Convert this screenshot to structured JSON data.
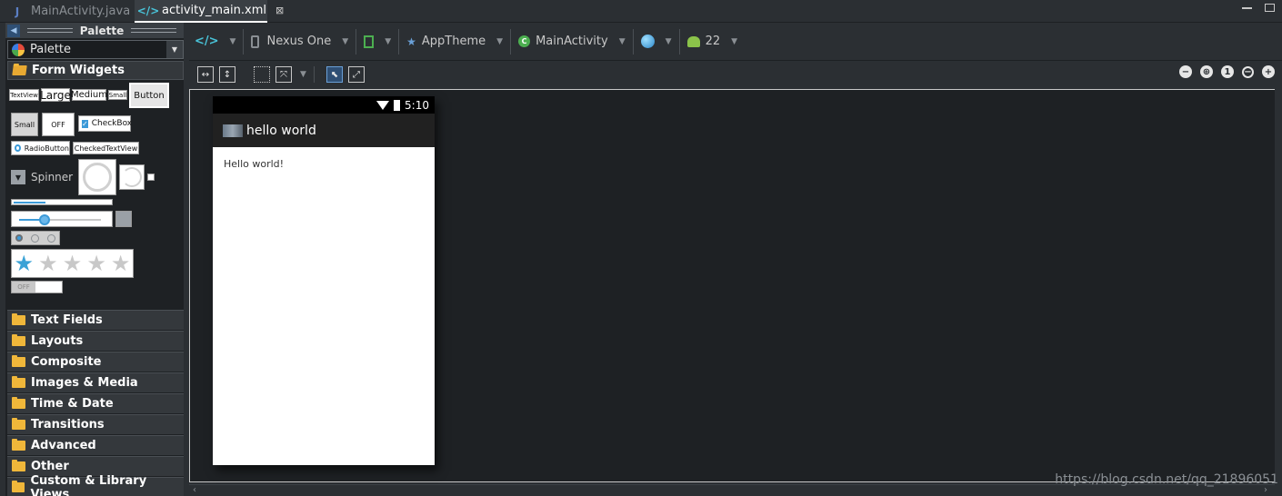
{
  "tabs": [
    {
      "label": "MainActivity.java",
      "icon": "java-file-icon"
    },
    {
      "label": "activity_main.xml",
      "icon": "xml-file-icon",
      "close": "⊠"
    }
  ],
  "palette": {
    "title": "Palette",
    "combo_label": "Palette",
    "open_category": "Form Widgets",
    "widgets": {
      "textview": "TextView",
      "large": "Large",
      "medium": "Medium",
      "small": "Small",
      "button": "Button",
      "small_button": "Small",
      "off": "OFF",
      "checkbox": "CheckBox",
      "radiobutton": "RadioButton",
      "checkedtextview": "CheckedTextView",
      "spinner": "Spinner",
      "switch_off": "OFF"
    },
    "categories": [
      "Text Fields",
      "Layouts",
      "Composite",
      "Images & Media",
      "Time & Date",
      "Transitions",
      "Advanced",
      "Other",
      "Custom & Library Views"
    ]
  },
  "toolbar": {
    "device": "Nexus One",
    "theme": "AppTheme",
    "activity": "MainActivity",
    "api": "22"
  },
  "device": {
    "time": "5:10",
    "app_title": "hello world",
    "content_text": "Hello world!"
  },
  "watermark": "https://blog.csdn.net/qq_21896051"
}
